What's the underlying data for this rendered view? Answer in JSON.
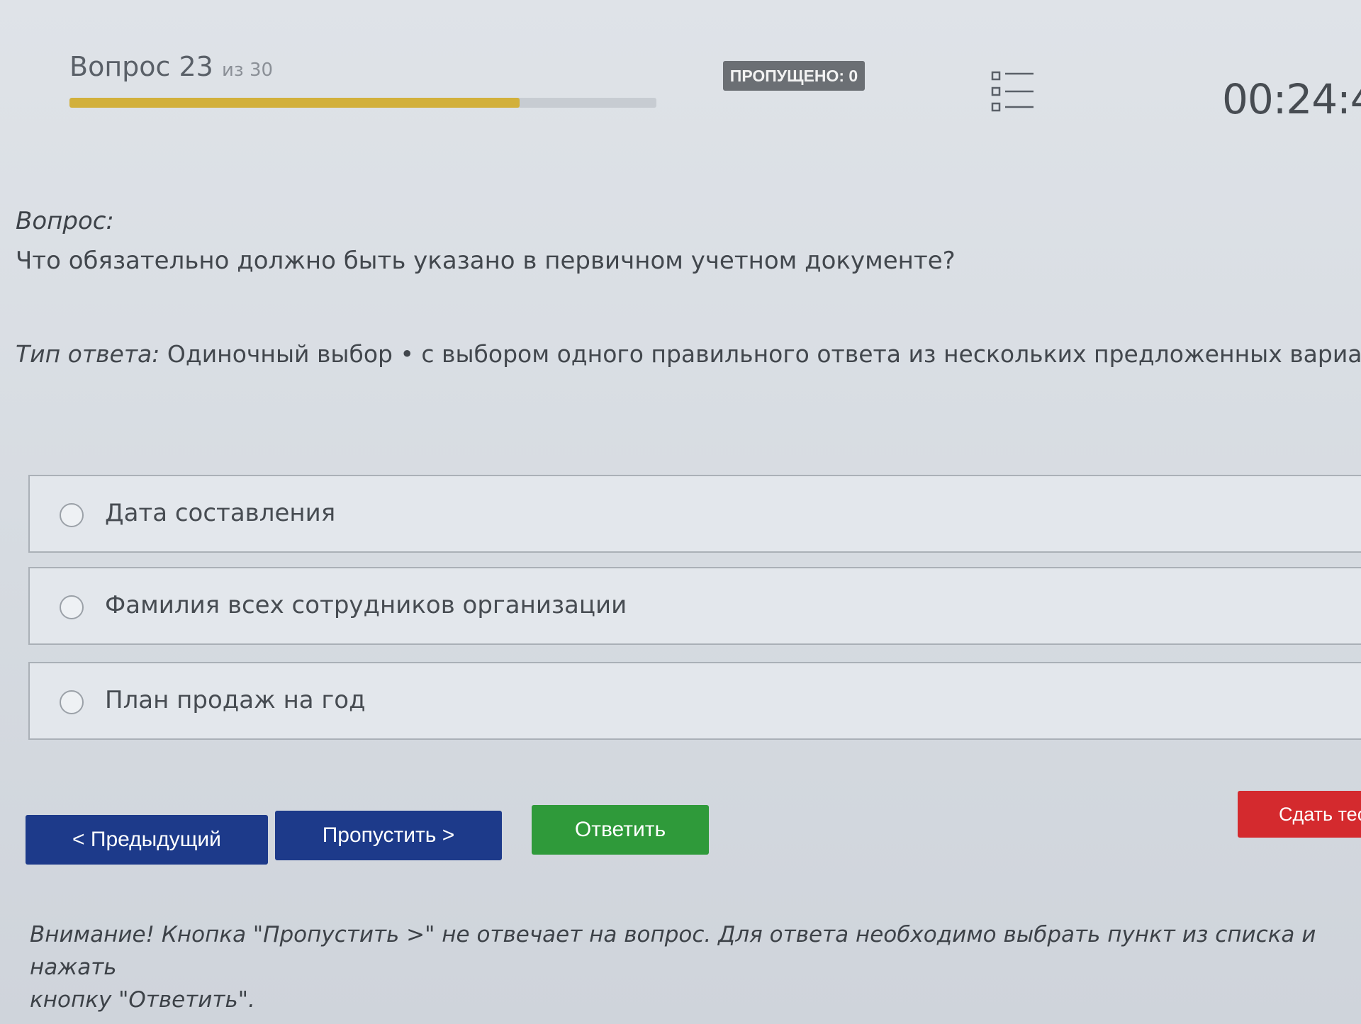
{
  "header": {
    "question_label": "Вопрос 23",
    "question_total": "из 30",
    "progress_fraction": 0.7667,
    "skipped_badge": "ПРОПУЩЕНО: 0",
    "list_icon": "question-list-icon",
    "timer": "00:24:4"
  },
  "question": {
    "label": "Вопрос:",
    "text": "Что обязательно должно быть указано в первичном учетном документе?"
  },
  "answer_type": {
    "label": "Тип ответа:",
    "value": "Одиночный выбор • с выбором одного правильного ответа из нескольких предложенных вариантов"
  },
  "options": [
    {
      "text": "Дата составления",
      "selected": false
    },
    {
      "text": "Фамилия всех сотрудников организации",
      "selected": false
    },
    {
      "text": "План продаж на год",
      "selected": false
    }
  ],
  "buttons": {
    "previous": "< Предыдущий",
    "skip": "Пропустить >",
    "answer": "Ответить",
    "submit": "Сдать тест"
  },
  "notice": {
    "line1": "Внимание! Кнопка \"Пропустить >\" не отвечает на вопрос. Для ответа необходимо выбрать пункт из списка и нажать",
    "line2": "кнопку \"Ответить\"."
  },
  "colors": {
    "progress": "#d2b03b",
    "nav_button": "#1d3a8a",
    "answer_button": "#2f9a3a",
    "submit_button": "#d42a2e",
    "badge": "#6b6f74"
  }
}
